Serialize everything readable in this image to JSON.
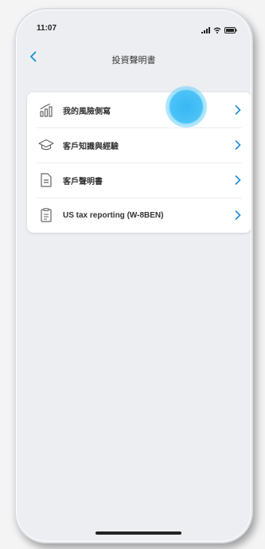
{
  "status_bar": {
    "time": "11:07"
  },
  "nav": {
    "title": "投資聲明書"
  },
  "menu": {
    "items": [
      {
        "label": "我的風險側寫",
        "icon": "risk-profile-chart-icon"
      },
      {
        "label": "客戶知識與經驗",
        "icon": "graduation-cap-icon"
      },
      {
        "label": "客戶聲明書",
        "icon": "document-icon"
      },
      {
        "label": "US tax reporting (W-8BEN)",
        "icon": "tax-form-icon"
      }
    ]
  },
  "colors": {
    "accent": "#1a8cd8",
    "background": "#eceef1",
    "card": "#ffffff",
    "touch_indicator": "#4cc3f7"
  }
}
